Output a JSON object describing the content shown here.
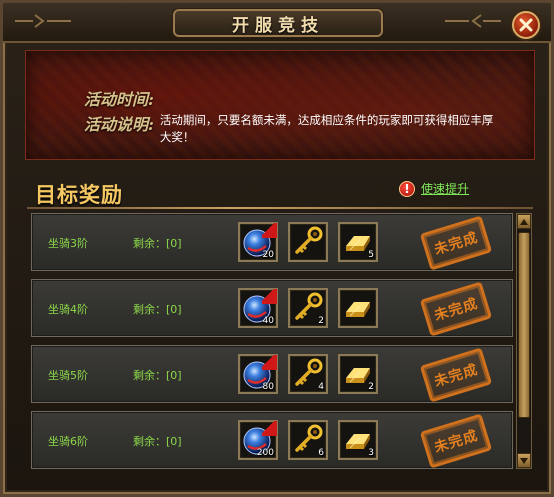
{
  "window": {
    "title": "开服竞技"
  },
  "banner": {
    "time_label": "活动时间:",
    "desc_label": "活动说明:",
    "desc_text": "活动期间，只要名额未满，达成相应条件的玩家即可获得相应丰厚大奖！"
  },
  "section": {
    "title": "目标奖励",
    "quick_boost_label": "使速提升"
  },
  "colors": {
    "accent_green": "#8bd84a",
    "title_gold": "#f6c862",
    "stamp_orange": "#e5801f"
  },
  "rows": [
    {
      "name": "坐骑3阶",
      "remain": "剩余：[0]",
      "status": "未完成",
      "rewards": [
        {
          "icon": "blue-orb-icon",
          "qty": "20",
          "limited": true
        },
        {
          "icon": "gold-key-icon",
          "qty": ""
        },
        {
          "icon": "gold-bar-icon",
          "qty": "5"
        }
      ]
    },
    {
      "name": "坐骑4阶",
      "remain": "剩余：[0]",
      "status": "未完成",
      "rewards": [
        {
          "icon": "blue-orb-icon",
          "qty": "40",
          "limited": true
        },
        {
          "icon": "gold-key-icon",
          "qty": "2"
        },
        {
          "icon": "gold-bar-icon",
          "qty": ""
        }
      ]
    },
    {
      "name": "坐骑5阶",
      "remain": "剩余：[0]",
      "status": "未完成",
      "rewards": [
        {
          "icon": "blue-orb-icon",
          "qty": "80",
          "limited": true
        },
        {
          "icon": "gold-key-icon",
          "qty": "4"
        },
        {
          "icon": "gold-bar-icon",
          "qty": "2"
        }
      ]
    },
    {
      "name": "坐骑6阶",
      "remain": "剩余：[0]",
      "status": "未完成",
      "rewards": [
        {
          "icon": "blue-orb-icon",
          "qty": "200",
          "limited": true
        },
        {
          "icon": "gold-key-icon",
          "qty": "6"
        },
        {
          "icon": "gold-bar-icon",
          "qty": "3"
        }
      ]
    }
  ]
}
